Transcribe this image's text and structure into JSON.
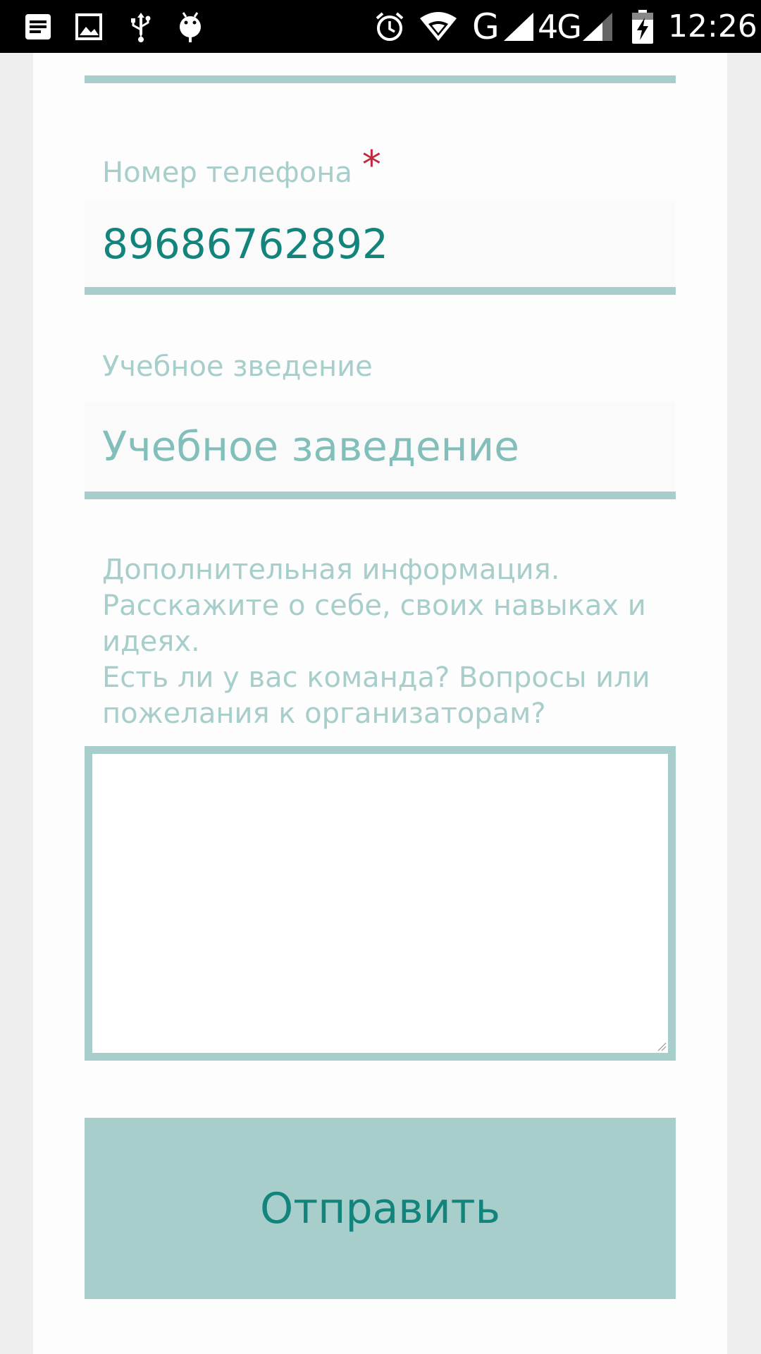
{
  "status_bar": {
    "time": "12:26",
    "network_type_g": "G",
    "network_type_4g": "4G",
    "left_icons": [
      "notes-icon",
      "image-icon",
      "usb-icon",
      "android-debug-icon"
    ],
    "right_icons": [
      "alarm-icon",
      "wifi-icon",
      "signal-icon",
      "signal-4g-icon",
      "battery-charging-icon"
    ]
  },
  "form": {
    "phone": {
      "label": "Номер телефона",
      "required_mark": "*",
      "value": "89686762892"
    },
    "school": {
      "label": "Учебное зведение",
      "placeholder": "Учебное заведение"
    },
    "additional_info": {
      "label_lines": [
        "Дополнительная информация.",
        "Расскажите о себе, своих навыках и",
        "идеях.",
        "Есть ли у вас команда? Вопросы или",
        "пожелания к организаторам?"
      ],
      "value": ""
    },
    "submit_label": "Отправить"
  },
  "colors": {
    "accent": "#a7cecb",
    "text_teal": "#13847c",
    "placeholder_teal": "#82bfbb",
    "required_red": "#c0283c"
  }
}
